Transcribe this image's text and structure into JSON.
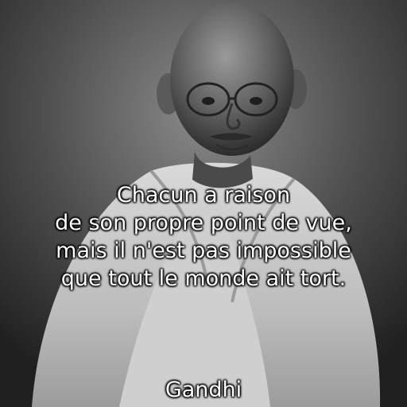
{
  "quote": {
    "lines": [
      "Chacun a raison",
      "de son propre point de vue,",
      "mais il n'est pas impossible",
      "que tout le monde ait tort."
    ],
    "author": "Gandhi"
  },
  "image": {
    "style": "black-and-white portrait",
    "colors": {
      "text": "#ffffff",
      "text_shadow": "#000000"
    }
  }
}
